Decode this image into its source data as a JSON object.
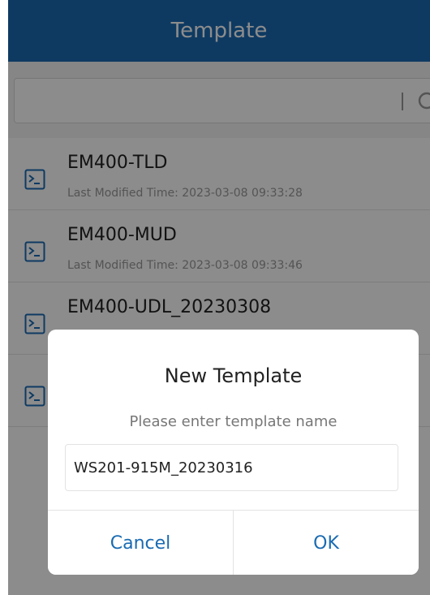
{
  "header": {
    "title": "Template"
  },
  "search": {
    "placeholder": "",
    "icon": "search-icon"
  },
  "list": {
    "items": [
      {
        "name": "EM400-TLD",
        "time": "Last Modified Time: 2023-03-08 09:33:28"
      },
      {
        "name": "EM400-MUD",
        "time": "Last Modified Time: 2023-03-08 09:33:46"
      },
      {
        "name": "EM400-UDL_20230308",
        "time": ""
      },
      {
        "name": "",
        "time": ""
      }
    ],
    "icon": "terminal-icon"
  },
  "dialog": {
    "title": "New Template",
    "hint": "Please enter template name",
    "input_value": "WS201-915M_20230316",
    "cancel_label": "Cancel",
    "ok_label": "OK"
  },
  "colors": {
    "accent": "#1a6bb2",
    "overlay": "rgba(0,0,0,0.45)"
  }
}
